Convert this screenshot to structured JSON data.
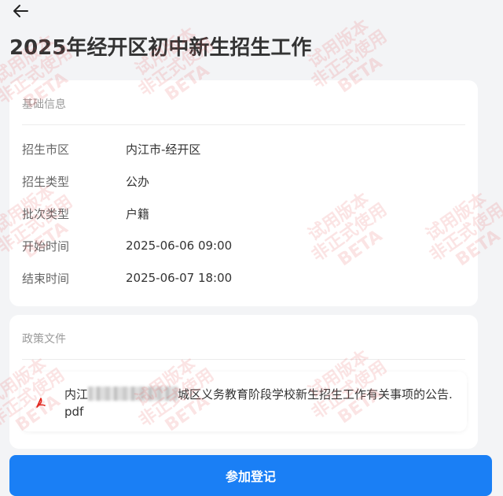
{
  "page": {
    "title": "2025年经开区初中新生招生工作"
  },
  "basic_info": {
    "section_title": "基础信息",
    "rows": [
      {
        "label": "招生市区",
        "value": "内江市-经开区"
      },
      {
        "label": "招生类型",
        "value": "公办"
      },
      {
        "label": "批次类型",
        "value": "户籍"
      },
      {
        "label": "开始时间",
        "value": "2025-06-06 09:00"
      },
      {
        "label": "结束时间",
        "value": "2025-06-07 18:00"
      }
    ]
  },
  "policy": {
    "section_title": "政策文件",
    "file": {
      "name_prefix": "内江",
      "name_suffix": "城区义务教育阶段学校新生招生工作有关事项的公告.pdf",
      "icon": "pdf-icon"
    }
  },
  "actions": {
    "register_label": "参加登记"
  },
  "watermark": {
    "line1": "试用版本",
    "line2": "非正式使用",
    "line3": "BETA"
  },
  "colors": {
    "primary": "#1a7ff5",
    "pdf_red": "#e2231a",
    "background": "#f3f4f6"
  }
}
